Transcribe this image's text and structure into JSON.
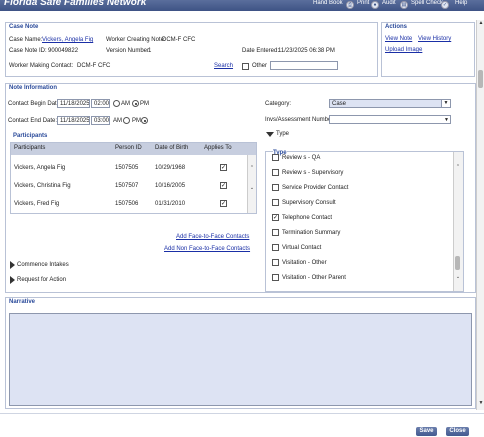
{
  "topbar": {
    "title": "Florida Safe Families Network",
    "handbook": "Hand Book",
    "print": "Print",
    "audit": "Audit",
    "spell_check": "Spell Check",
    "help": "Help"
  },
  "case_note": {
    "heading": "Case Note",
    "case_name_label": "Case Name:",
    "case_name_value": "Vickers, Angela Fig",
    "case_note_id_label": "Case Note ID:",
    "case_note_id_value": "900049822",
    "worker_creating_label": "Worker Creating Note:",
    "worker_creating_value": "DCM-F CFC",
    "version_label": "Version Number:",
    "version_value": "1",
    "date_entered_label": "Date Entered:",
    "date_entered_value": "11/23/2025 06:38 PM",
    "worker_making_label": "Worker Making Contact:",
    "worker_making_value": "DCM-F CFC",
    "search_link": "Search",
    "other_label": "Other"
  },
  "actions": {
    "heading": "Actions",
    "view_note": "View Note",
    "view_history": "View History",
    "upload_image": "Upload Image"
  },
  "note_info": {
    "heading": "Note Information",
    "begin_label": "Contact Begin Date:",
    "begin_date": "11/18/2025",
    "begin_time": "02:00",
    "end_label": "Contact End Date:",
    "end_date": "11/18/2025",
    "end_time": "03:00",
    "am": "AM",
    "pm": "PM",
    "category_label": "Category:",
    "category_value": "Case",
    "invs_label": "Invs/Assessment Number:",
    "invs_value": "",
    "type_toggle": "Type",
    "type_heading": "Type"
  },
  "participants": {
    "heading": "Participants",
    "columns": [
      "Participants",
      "Person ID",
      "Date of Birth",
      "Applies To"
    ],
    "rows": [
      {
        "name": "Vickers, Angela Fig",
        "id": "1507505",
        "dob": "10/29/1968",
        "applies": "✓"
      },
      {
        "name": "Vickers, Christina Fig",
        "id": "1507507",
        "dob": "10/16/2005",
        "applies": "✓"
      },
      {
        "name": "Vickers, Fred Fig",
        "id": "1507506",
        "dob": "01/31/2010",
        "applies": "✓"
      }
    ],
    "add_f2f": "Add Face-to-Face Contacts",
    "add_nonf2f": "Add Non Face-to-Face Contacts"
  },
  "type_list": [
    {
      "label": "Review s - QA",
      "checked": false
    },
    {
      "label": "Review s - Supervisory",
      "checked": false
    },
    {
      "label": "Service Provider Contact",
      "checked": false
    },
    {
      "label": "Supervisory Consult",
      "checked": false
    },
    {
      "label": "Telephone Contact",
      "checked": true
    },
    {
      "label": "Termination Summary",
      "checked": false
    },
    {
      "label": "Virtual Contact",
      "checked": false
    },
    {
      "label": "Visitation - Other",
      "checked": false
    },
    {
      "label": "Visitation - Other Parent",
      "checked": false
    }
  ],
  "left_links": {
    "commence": "Commence Intakes",
    "request": "Request for Action"
  },
  "narrative": {
    "heading": "Narrative",
    "text": ""
  },
  "footer": {
    "save": "Save",
    "close": "Close"
  },
  "colors": {
    "header_bar": "#3e5385",
    "link": "#1a2fa6",
    "narrative_bg": "#dde3f3",
    "table_head": "#c7cedf"
  }
}
